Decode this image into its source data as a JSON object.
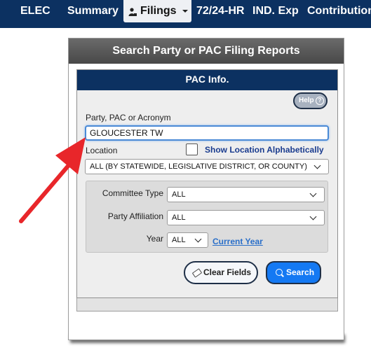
{
  "nav": {
    "elec": "ELEC",
    "summary": "Summary",
    "filings": "Filings",
    "hr": "72/24-HR",
    "ind_exp": "IND. Exp",
    "contributions": "Contributions"
  },
  "panel": {
    "title": "Search Party or PAC Filing Reports",
    "section_title": "PAC Info.",
    "help_label": "Help",
    "help_glyph": "?",
    "party_label": "Party, PAC or Acronym",
    "party_value": "GLOUCESTER TW",
    "location_label": "Location",
    "show_alpha_label": "Show Location Alphabetically",
    "location_value": "ALL (BY STATEWIDE, LEGISLATIVE DISTRICT, OR COUNTY)",
    "committee_type_label": "Committee Type",
    "committee_type_value": "ALL",
    "party_affiliation_label": "Party Affiliation",
    "party_affiliation_value": "ALL",
    "year_label": "Year",
    "year_value": "ALL",
    "current_year_link": "Current Year",
    "clear_button": "Clear Fields",
    "search_button": "Search"
  },
  "annotation": {
    "arrow_color": "#e8262a"
  }
}
